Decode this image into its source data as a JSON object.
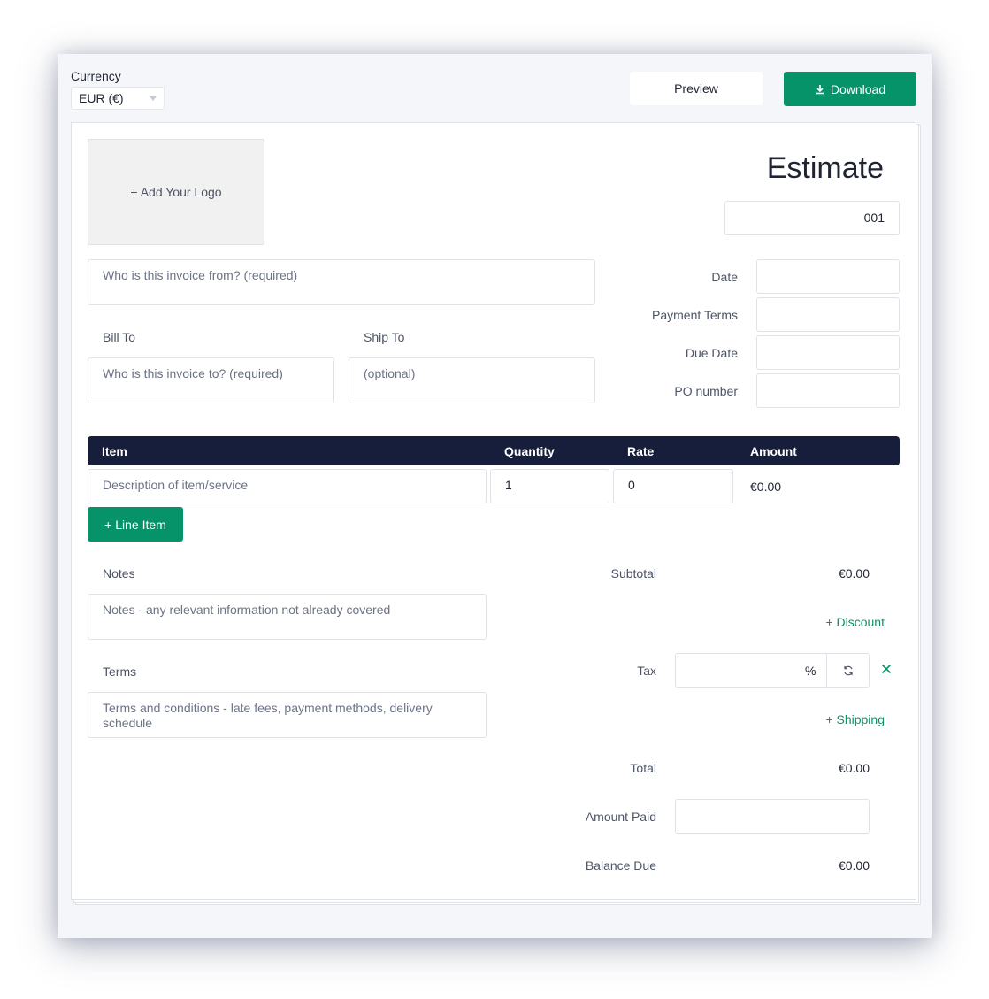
{
  "toolbar": {
    "currency_label": "Currency",
    "currency_value": "EUR (€)",
    "preview_label": "Preview",
    "download_label": "Download"
  },
  "header": {
    "logo_placeholder": "+ Add Your Logo",
    "title": "Estimate",
    "number": "001"
  },
  "parties": {
    "from_placeholder": "Who is this invoice from? (required)",
    "bill_to_label": "Bill To",
    "bill_to_placeholder": "Who is this invoice to? (required)",
    "ship_to_label": "Ship To",
    "ship_to_placeholder": "(optional)"
  },
  "meta": {
    "date_label": "Date",
    "payment_terms_label": "Payment Terms",
    "due_date_label": "Due Date",
    "po_number_label": "PO number"
  },
  "items": {
    "columns": {
      "item": "Item",
      "quantity": "Quantity",
      "rate": "Rate",
      "amount": "Amount"
    },
    "rows": [
      {
        "description_placeholder": "Description of item/service",
        "quantity": "1",
        "rate": "0",
        "amount": "€0.00"
      }
    ],
    "add_line_label": "+ Line Item"
  },
  "notes": {
    "notes_label": "Notes",
    "notes_placeholder": "Notes - any relevant information not already covered",
    "terms_label": "Terms",
    "terms_placeholder": "Terms and conditions - late fees, payment methods, delivery schedule"
  },
  "totals": {
    "subtotal_label": "Subtotal",
    "subtotal_value": "€0.00",
    "discount_link": "+ Discount",
    "tax_label": "Tax",
    "tax_unit": "%",
    "shipping_link": "+ Shipping",
    "total_label": "Total",
    "total_value": "€0.00",
    "amount_paid_label": "Amount Paid",
    "balance_due_label": "Balance Due",
    "balance_due_value": "€0.00"
  },
  "colors": {
    "accent": "#07936a",
    "header_bg": "#161e3b",
    "frame_bg": "#f4f6f9"
  }
}
